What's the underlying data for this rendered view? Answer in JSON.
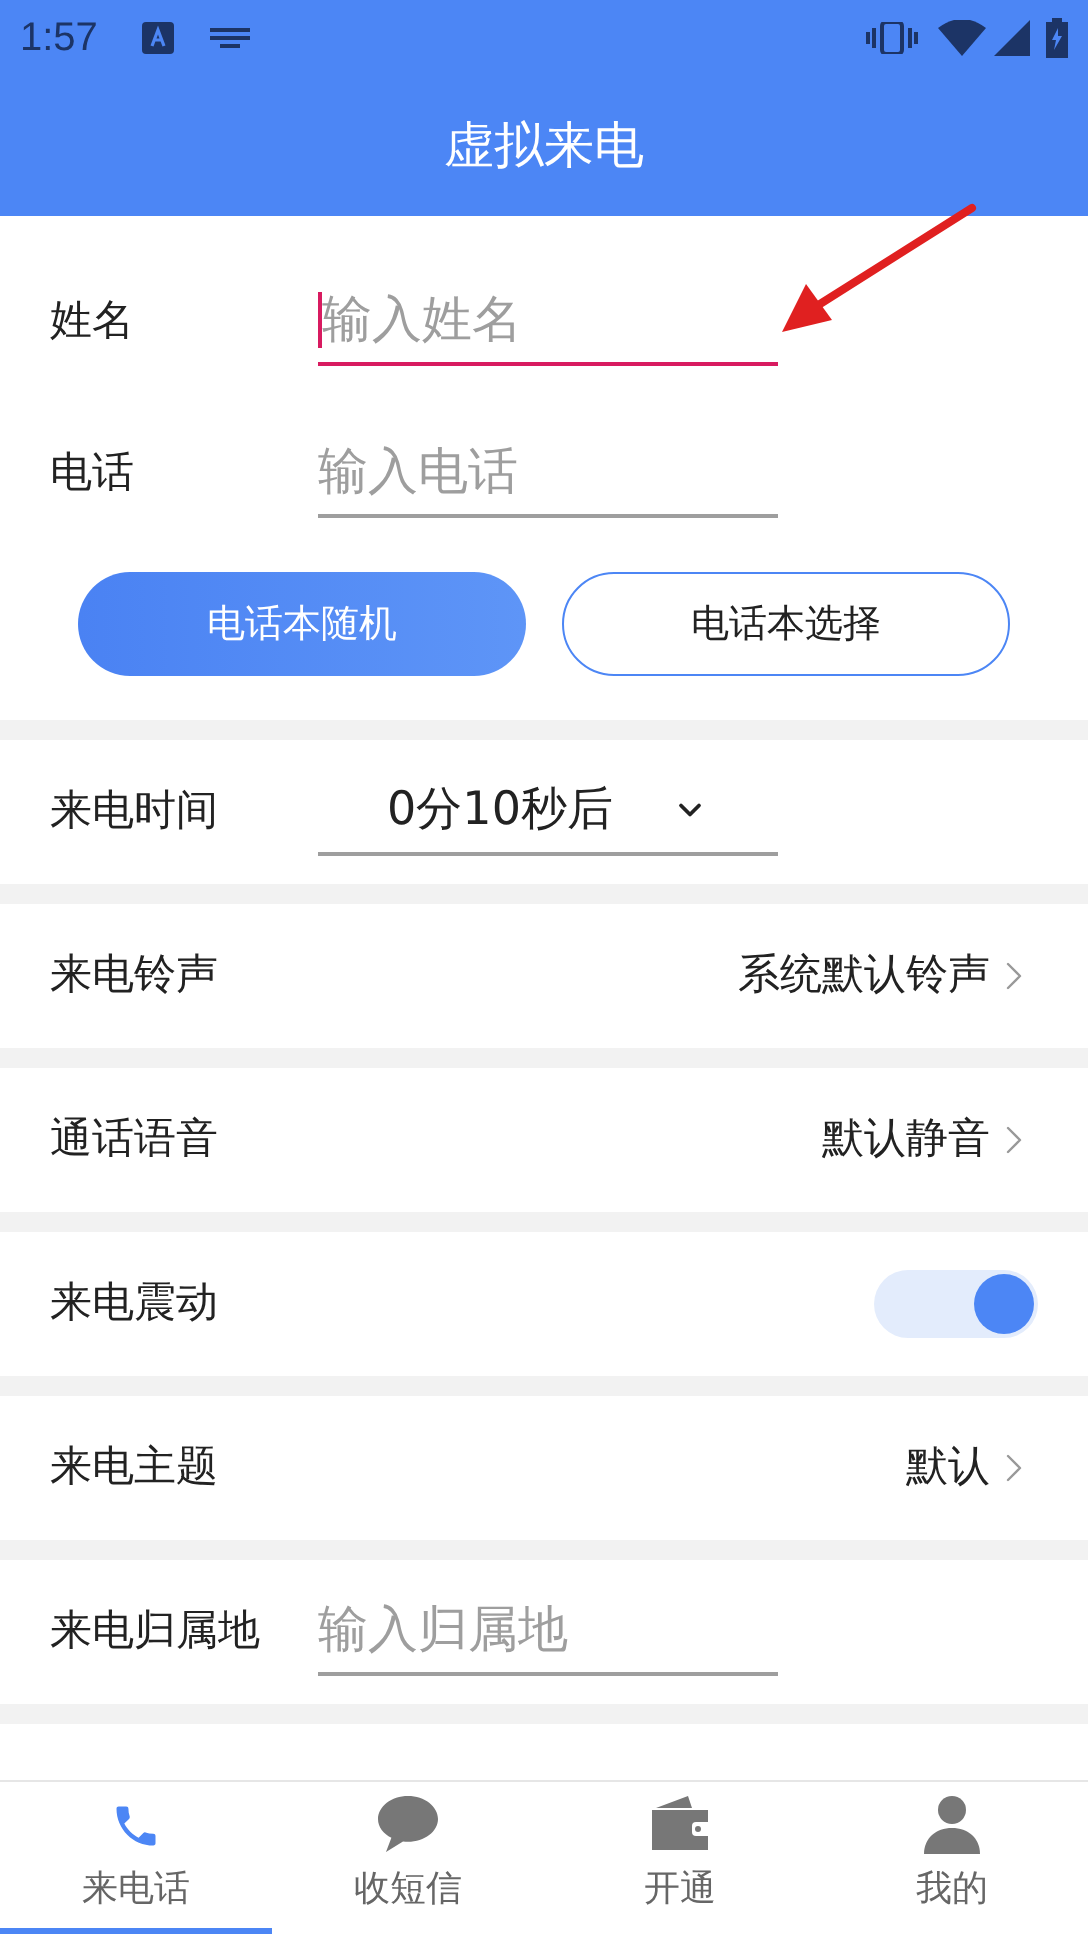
{
  "status_bar": {
    "time": "1:57"
  },
  "header": {
    "title": "虚拟来电"
  },
  "form": {
    "name": {
      "label": "姓名",
      "placeholder": "输入姓名",
      "focused": true
    },
    "phone": {
      "label": "电话",
      "placeholder": "输入电话",
      "focused": false
    },
    "buttons": [
      {
        "label": "电话本随机",
        "selected": true
      },
      {
        "label": "电话本选择",
        "selected": false
      }
    ]
  },
  "settings": [
    {
      "kind": "dropdown",
      "label": "来电时间",
      "value": "0分10秒后"
    },
    {
      "kind": "link",
      "label": "来电铃声",
      "value": "系统默认铃声"
    },
    {
      "kind": "link",
      "label": "通话语音",
      "value": "默认静音"
    },
    {
      "kind": "switch",
      "label": "来电震动",
      "on": true
    },
    {
      "kind": "link",
      "label": "来电主题",
      "value": "默认"
    },
    {
      "kind": "input",
      "label": "来电归属地",
      "placeholder": "输入归属地"
    }
  ],
  "bottom_nav": [
    {
      "kind": "phone",
      "label": "来电话",
      "selected": true
    },
    {
      "kind": "chat",
      "label": "收短信",
      "selected": false
    },
    {
      "kind": "wallet",
      "label": "开通",
      "selected": false
    },
    {
      "kind": "person",
      "label": "我的",
      "selected": false
    }
  ]
}
